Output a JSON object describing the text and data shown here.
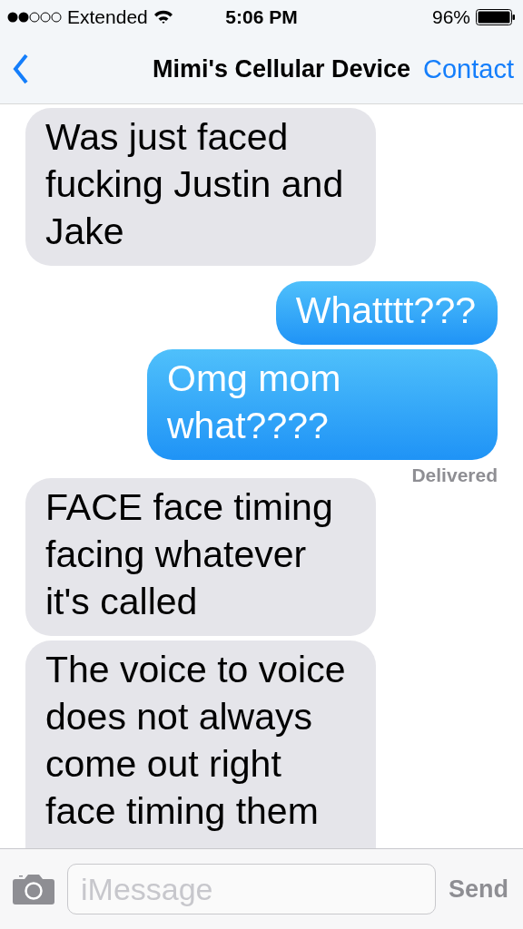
{
  "status_bar": {
    "carrier": "Extended",
    "time": "5:06 PM",
    "battery": "96%"
  },
  "nav": {
    "title": "Mimi's Cellular Device",
    "action": "Contact"
  },
  "messages": [
    {
      "kind": "received",
      "text": "Was just faced fucking Justin and Jake"
    },
    {
      "kind": "sent",
      "text": "Whatttt???"
    },
    {
      "kind": "sent",
      "text": "Omg mom what????",
      "receipt": "Delivered"
    },
    {
      "kind": "received",
      "text": "FACE face timing facing whatever it's called"
    },
    {
      "kind": "received",
      "text": "The voice to voice does not always come out right face timing them"
    }
  ],
  "composer": {
    "placeholder": "iMessage",
    "send": "Send"
  }
}
